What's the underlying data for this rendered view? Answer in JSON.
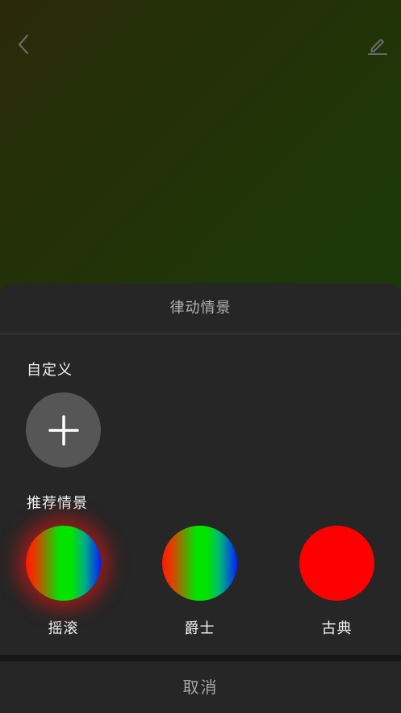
{
  "header": {
    "back_icon": "chevron-left-icon",
    "edit_icon": "pencil-icon"
  },
  "sheet": {
    "title": "律动情景",
    "custom_section_label": "自定义",
    "add_icon": "plus-icon",
    "recommended_section_label": "推荐情景",
    "scenes": [
      {
        "label": "摇滚",
        "style": "rgb-gradient",
        "selected": true
      },
      {
        "label": "爵士",
        "style": "rgb-gradient",
        "selected": false
      },
      {
        "label": "古典",
        "style": "solid-red",
        "selected": false
      }
    ]
  },
  "footer": {
    "cancel_label": "取消"
  },
  "colors": {
    "sheet_background": "#262626",
    "add_button_background": "#565656",
    "classic_red": "#ff0000",
    "selected_glow": "#e61414"
  }
}
